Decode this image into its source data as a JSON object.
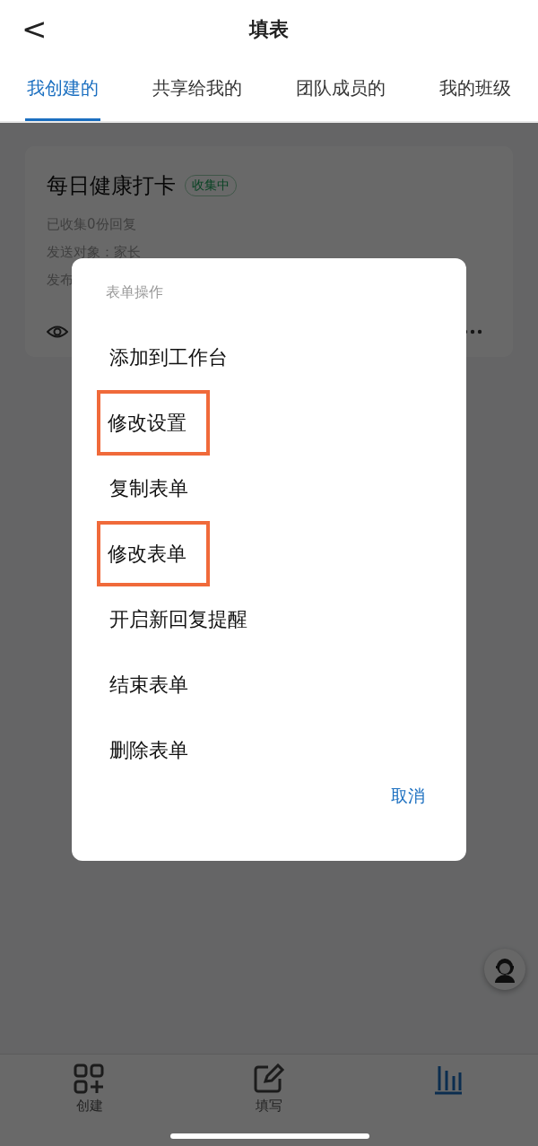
{
  "header": {
    "back": "<",
    "title": "填表"
  },
  "tabs": [
    {
      "label": "我创建的",
      "selected": true
    },
    {
      "label": "共享给我的",
      "selected": false
    },
    {
      "label": "团队成员的",
      "selected": false
    },
    {
      "label": "我的班级",
      "selected": false
    }
  ],
  "form_card": {
    "title": "每日健康打卡",
    "status": "收集中",
    "lines": [
      "已收集0份回复",
      "发送对象：家长",
      "发布"
    ]
  },
  "bottom_nav": [
    {
      "kind": "create",
      "label": "创建",
      "selected": false
    },
    {
      "kind": "fill",
      "label": "填写",
      "selected": false
    },
    {
      "kind": "stats",
      "selected": true
    }
  ],
  "dialog": {
    "title": "表单操作",
    "items": [
      {
        "label": "添加到工作台",
        "highlighted": false
      },
      {
        "label": "修改设置",
        "highlighted": true
      },
      {
        "label": "复制表单",
        "highlighted": false
      },
      {
        "label": "修改表单",
        "highlighted": true
      },
      {
        "label": "开启新回复提醒",
        "highlighted": false
      },
      {
        "label": "结束表单",
        "highlighted": false
      },
      {
        "label": "删除表单",
        "highlighted": false
      }
    ],
    "cancel": "取消"
  }
}
